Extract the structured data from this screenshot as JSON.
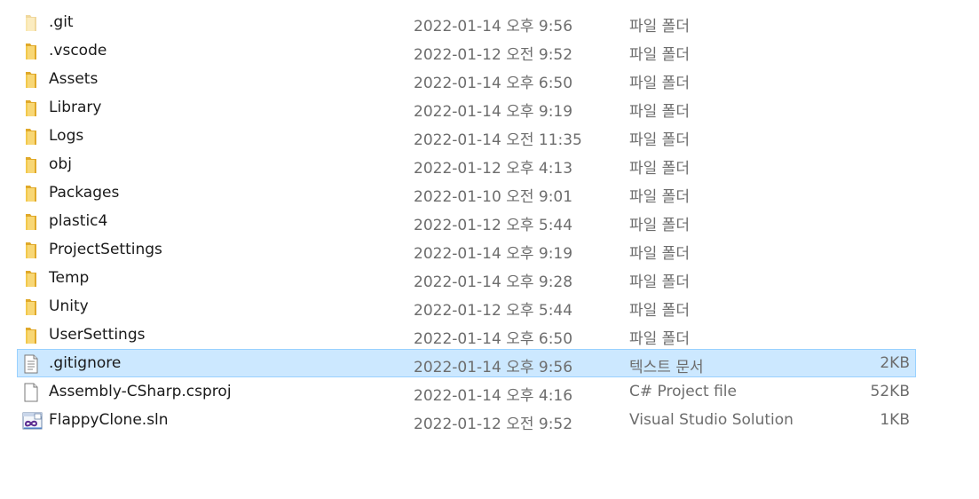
{
  "files": [
    {
      "name": ".git",
      "modified": "2022-01-14 오후 9:56",
      "type": "파일 폴더",
      "size": "",
      "icon": "folder-icon",
      "hidden": true
    },
    {
      "name": ".vscode",
      "modified": "2022-01-12 오전 9:52",
      "type": "파일 폴더",
      "size": "",
      "icon": "folder-icon"
    },
    {
      "name": "Assets",
      "modified": "2022-01-14 오후 6:50",
      "type": "파일 폴더",
      "size": "",
      "icon": "folder-icon"
    },
    {
      "name": "Library",
      "modified": "2022-01-14 오후 9:19",
      "type": "파일 폴더",
      "size": "",
      "icon": "folder-icon"
    },
    {
      "name": "Logs",
      "modified": "2022-01-14 오전 11:35",
      "type": "파일 폴더",
      "size": "",
      "icon": "folder-icon"
    },
    {
      "name": "obj",
      "modified": "2022-01-12 오후 4:13",
      "type": "파일 폴더",
      "size": "",
      "icon": "folder-icon"
    },
    {
      "name": "Packages",
      "modified": "2022-01-10 오전 9:01",
      "type": "파일 폴더",
      "size": "",
      "icon": "folder-icon"
    },
    {
      "name": "plastic4",
      "modified": "2022-01-12 오후 5:44",
      "type": "파일 폴더",
      "size": "",
      "icon": "folder-icon"
    },
    {
      "name": "ProjectSettings",
      "modified": "2022-01-14 오후 9:19",
      "type": "파일 폴더",
      "size": "",
      "icon": "folder-icon"
    },
    {
      "name": "Temp",
      "modified": "2022-01-14 오후 9:28",
      "type": "파일 폴더",
      "size": "",
      "icon": "folder-icon"
    },
    {
      "name": "Unity",
      "modified": "2022-01-12 오후 5:44",
      "type": "파일 폴더",
      "size": "",
      "icon": "folder-icon"
    },
    {
      "name": "UserSettings",
      "modified": "2022-01-14 오후 6:50",
      "type": "파일 폴더",
      "size": "",
      "icon": "folder-icon"
    },
    {
      "name": ".gitignore",
      "modified": "2022-01-14 오후 9:56",
      "type": "텍스트 문서",
      "size": "2KB",
      "icon": "text-document-icon",
      "selected": true
    },
    {
      "name": "Assembly-CSharp.csproj",
      "modified": "2022-01-14 오후 4:16",
      "type": "C# Project file",
      "size": "52KB",
      "icon": "blank-file-icon"
    },
    {
      "name": "FlappyClone.sln",
      "modified": "2022-01-12 오전 9:52",
      "type": "Visual Studio Solution",
      "size": "1KB",
      "icon": "visual-studio-solution-icon"
    }
  ],
  "colors": {
    "selection_bg": "#cce8ff",
    "selection_border": "#99d1ff",
    "folder_yellow": "#f8d775",
    "secondary_text": "#6d6d6d"
  }
}
